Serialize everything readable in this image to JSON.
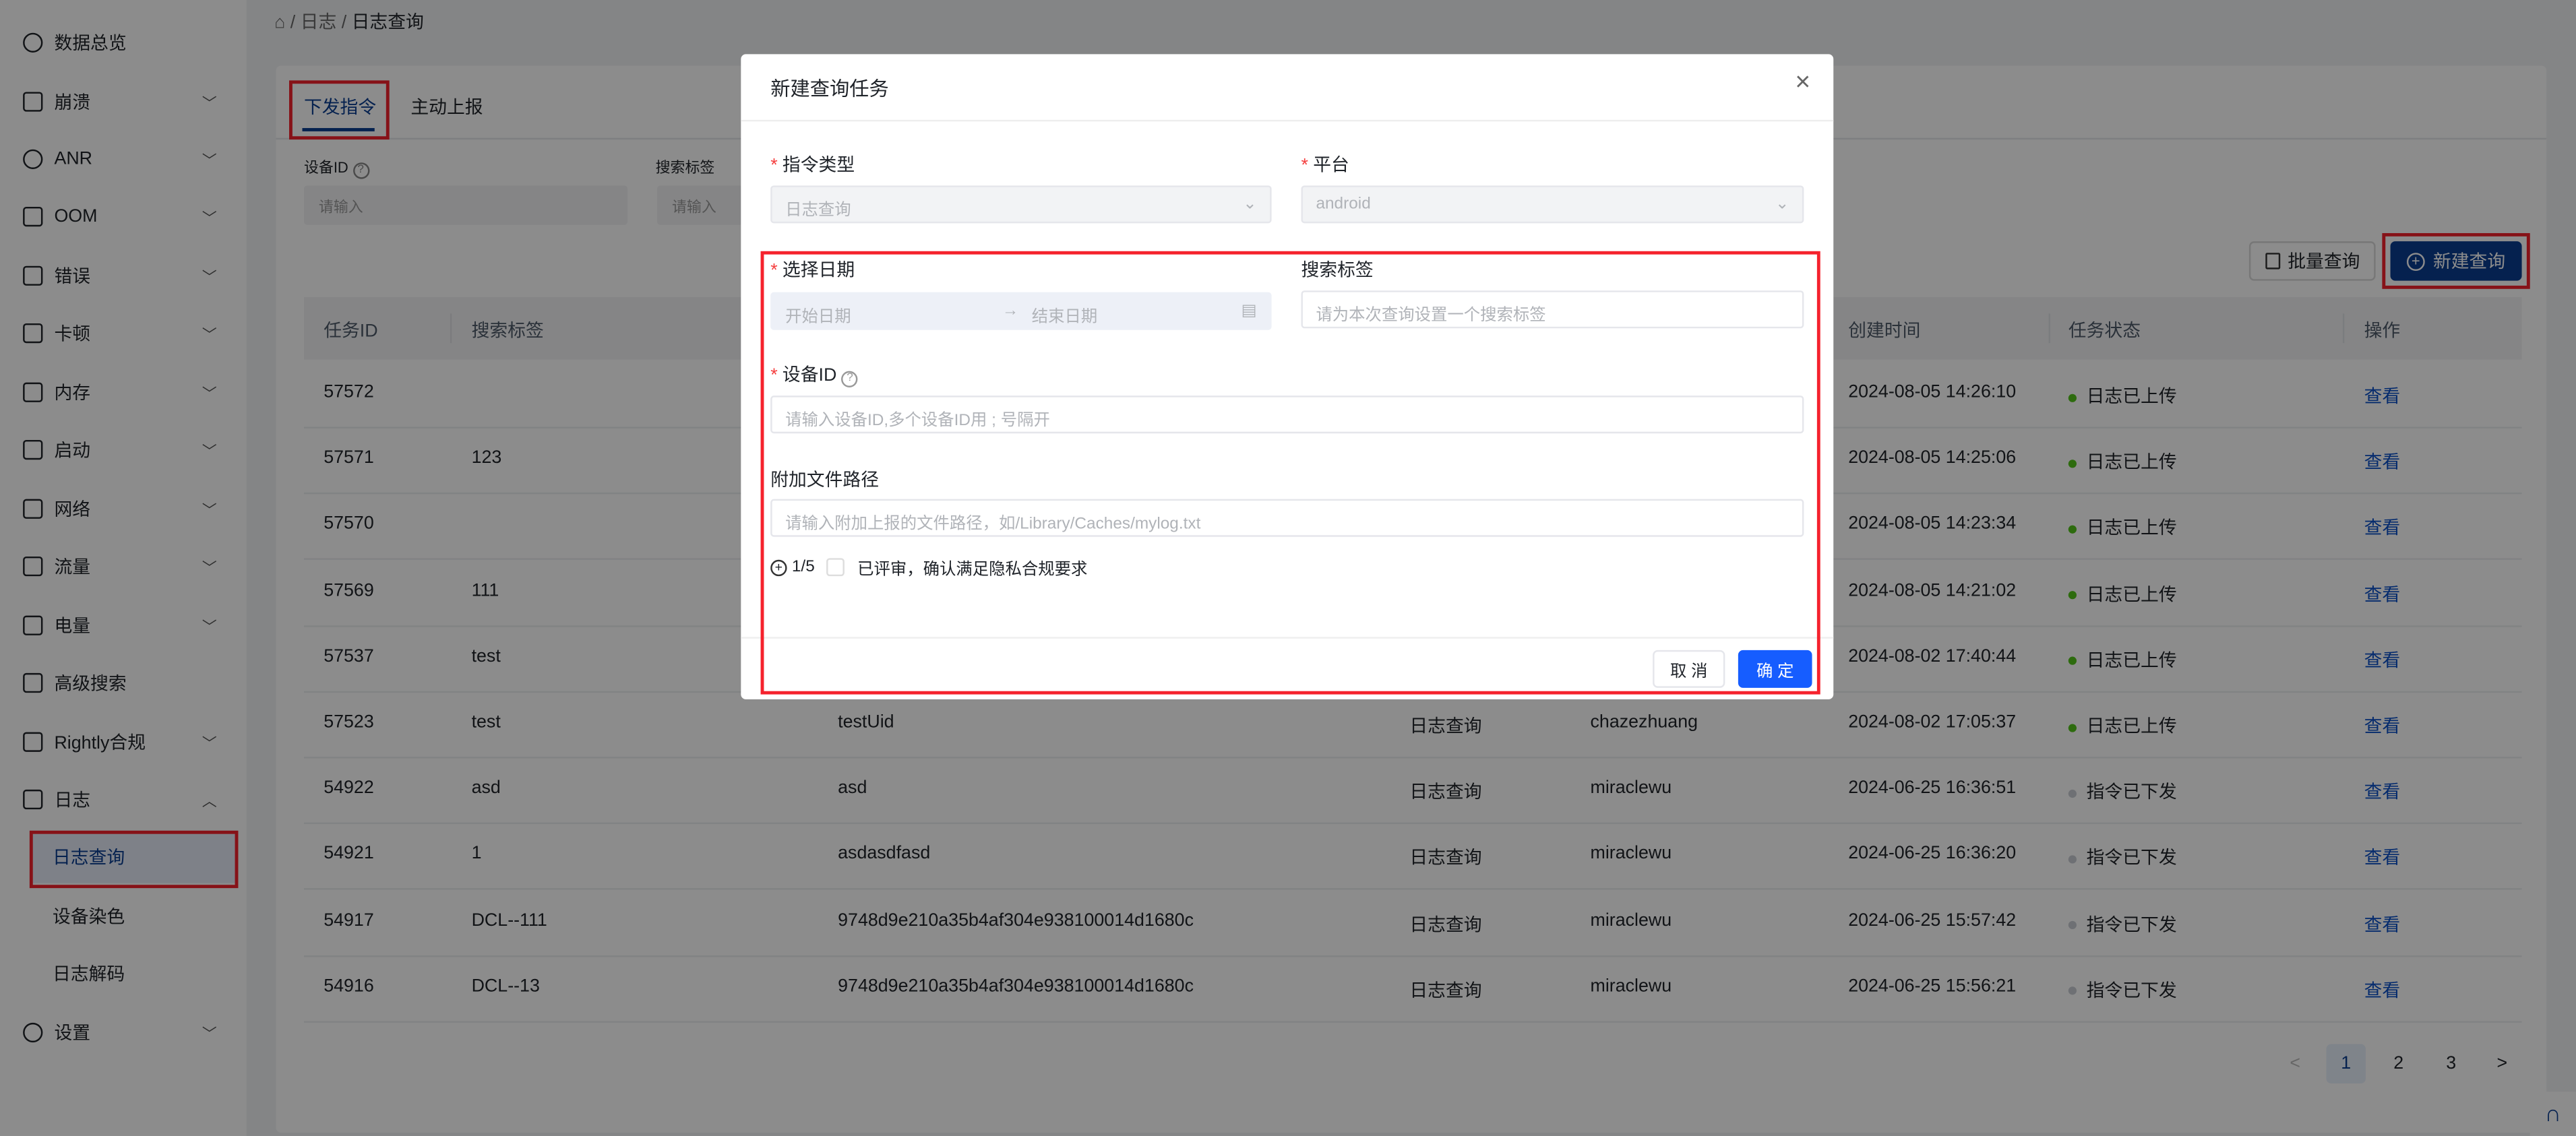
{
  "breadcrumb": {
    "level1": "日志",
    "level2": "日志查询"
  },
  "sidebar": {
    "items": [
      {
        "label": "数据总览",
        "icon": "pie-chart-icon",
        "chevron": false
      },
      {
        "label": "崩溃",
        "icon": "crash-icon",
        "chevron": true
      },
      {
        "label": "ANR",
        "icon": "anr-icon",
        "chevron": true
      },
      {
        "label": "OOM",
        "icon": "oom-icon",
        "chevron": true
      },
      {
        "label": "错误",
        "icon": "error-doc-icon",
        "chevron": true
      },
      {
        "label": "卡顿",
        "icon": "lag-monitor-icon",
        "chevron": true
      },
      {
        "label": "内存",
        "icon": "memory-icon",
        "chevron": true
      },
      {
        "label": "启动",
        "icon": "launch-icon",
        "chevron": true
      },
      {
        "label": "网络",
        "icon": "network-icon",
        "chevron": true
      },
      {
        "label": "流量",
        "icon": "traffic-chart-icon",
        "chevron": true
      },
      {
        "label": "电量",
        "icon": "battery-icon",
        "chevron": true
      },
      {
        "label": "高级搜索",
        "icon": "advanced-search-icon",
        "chevron": false
      },
      {
        "label": "Rightly合规",
        "icon": "compliance-icon",
        "chevron": true
      },
      {
        "label": "日志",
        "icon": "log-icon",
        "chevron": true,
        "expanded": true
      },
      {
        "label": "日志查询",
        "sub": true,
        "active": true
      },
      {
        "label": "设备染色",
        "sub": true
      },
      {
        "label": "日志解码",
        "sub": true
      },
      {
        "label": "设置",
        "icon": "settings-icon",
        "chevron": true
      }
    ]
  },
  "tabs": [
    {
      "label": "下发指令",
      "active": true
    },
    {
      "label": "主动上报"
    }
  ],
  "filters": {
    "device_id_label": "设备ID",
    "device_id_placeholder": "请输入",
    "tag_label": "搜索标签",
    "tag_placeholder": "请输入"
  },
  "toolbar": {
    "batch_label": "批量查询",
    "new_label": "新建查询"
  },
  "table": {
    "headers": [
      "任务ID",
      "搜索标签",
      "",
      "",
      "",
      "创建时间",
      "任务状态",
      "操作"
    ],
    "rows": [
      {
        "id": "57572",
        "tag": "",
        "device": "",
        "type": "",
        "creator": "",
        "time": "2024-08-05 14:26:10",
        "status": "日志已上传",
        "done": true,
        "action": "查看"
      },
      {
        "id": "57571",
        "tag": "123",
        "device": "",
        "type": "",
        "creator": "",
        "time": "2024-08-05 14:25:06",
        "status": "日志已上传",
        "done": true,
        "action": "查看"
      },
      {
        "id": "57570",
        "tag": "",
        "device": "",
        "type": "",
        "creator": "",
        "time": "2024-08-05 14:23:34",
        "status": "日志已上传",
        "done": true,
        "action": "查看"
      },
      {
        "id": "57569",
        "tag": "111",
        "device": "",
        "type": "",
        "creator": "",
        "time": "2024-08-05 14:21:02",
        "status": "日志已上传",
        "done": true,
        "action": "查看"
      },
      {
        "id": "57537",
        "tag": "test",
        "device": "",
        "type": "",
        "creator": "",
        "time": "2024-08-02 17:40:44",
        "status": "日志已上传",
        "done": true,
        "action": "查看"
      },
      {
        "id": "57523",
        "tag": "test",
        "device": "testUid",
        "type": "日志查询",
        "creator": "chazezhuang",
        "time": "2024-08-02 17:05:37",
        "status": "日志已上传",
        "done": true,
        "action": "查看"
      },
      {
        "id": "54922",
        "tag": "asd",
        "device": "asd",
        "type": "日志查询",
        "creator": "miraclewu",
        "time": "2024-06-25 16:36:51",
        "status": "指令已下发",
        "done": false,
        "action": "查看"
      },
      {
        "id": "54921",
        "tag": "1",
        "device": "asdasdfasd",
        "type": "日志查询",
        "creator": "miraclewu",
        "time": "2024-06-25 16:36:20",
        "status": "指令已下发",
        "done": false,
        "action": "查看"
      },
      {
        "id": "54917",
        "tag": "DCL--111",
        "device": "9748d9e210a35b4af304e938100014d1680c",
        "type": "日志查询",
        "creator": "miraclewu",
        "time": "2024-06-25 15:57:42",
        "status": "指令已下发",
        "done": false,
        "action": "查看"
      },
      {
        "id": "54916",
        "tag": "DCL--13",
        "device": "9748d9e210a35b4af304e938100014d1680c",
        "type": "日志查询",
        "creator": "miraclewu",
        "time": "2024-06-25 15:56:21",
        "status": "指令已下发",
        "done": false,
        "action": "查看"
      }
    ]
  },
  "pagination": {
    "pages": [
      "1",
      "2",
      "3"
    ],
    "current": "1",
    "prev": "<",
    "next": ">"
  },
  "modal": {
    "title": "新建查询任务",
    "close": "×",
    "cmd_type_label": "指令类型",
    "cmd_type_value": "日志查询",
    "platform_label": "平台",
    "platform_value": "android",
    "date_label": "选择日期",
    "date_start_placeholder": "开始日期",
    "date_arrow": "→",
    "date_end_placeholder": "结束日期",
    "tag_label": "搜索标签",
    "tag_placeholder": "请为本次查询设置一个搜索标签",
    "device_label": "设备ID",
    "device_placeholder": "请输入设备ID,多个设备ID用 ; 号隔开",
    "path_label": "附加文件路径",
    "path_placeholder": "请输入附加上报的文件路径，如/Library/Caches/mylog.txt",
    "path_count": "1/5",
    "consent_label": "已评审，确认满足隐私合规要求",
    "consent_checked": false,
    "cancel_label": "取 消",
    "ok_label": "确 定"
  },
  "colors": {
    "primary": "#0a3d91",
    "modal_primary": "#165dff",
    "annotation": "#f5222d",
    "success": "#52c41a",
    "pending": "#c9cdd4"
  }
}
